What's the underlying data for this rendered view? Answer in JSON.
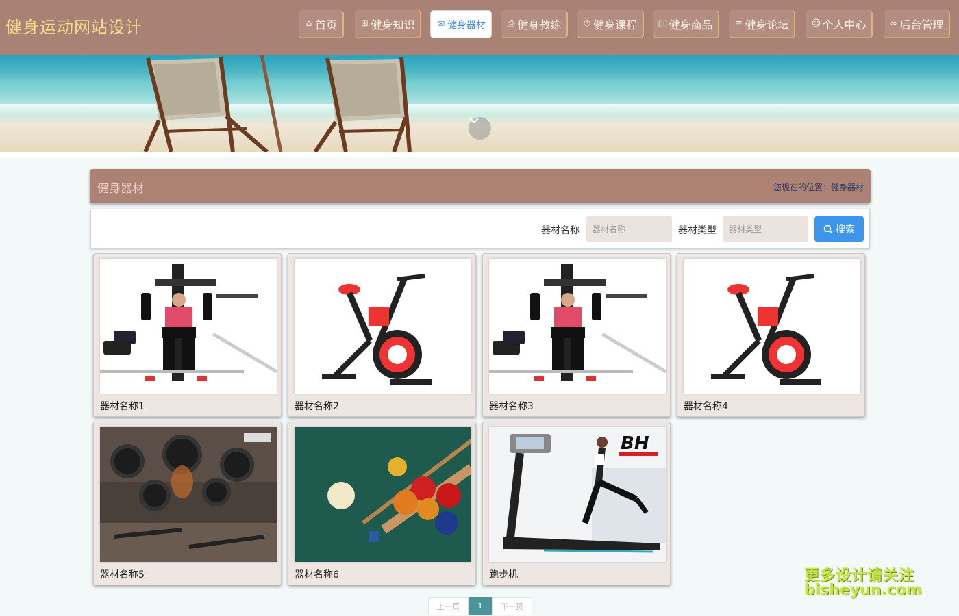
{
  "header": {
    "site_title": "健身运动网站设计",
    "nav": [
      {
        "label": "首页",
        "icon": "home-icon",
        "glyph": "⌂",
        "active": false
      },
      {
        "label": "健身知识",
        "icon": "gift-icon",
        "glyph": "⊞",
        "active": false
      },
      {
        "label": "健身器材",
        "icon": "mail-icon",
        "glyph": "✉",
        "active": true
      },
      {
        "label": "健身教练",
        "icon": "printer-icon",
        "glyph": "⎙",
        "active": false
      },
      {
        "label": "健身课程",
        "icon": "power-icon",
        "glyph": "⏻",
        "active": false
      },
      {
        "label": "健身商品",
        "icon": "book-icon",
        "glyph": "▯▯",
        "active": false
      },
      {
        "label": "健身论坛",
        "icon": "list-icon",
        "glyph": "≡",
        "active": false
      },
      {
        "label": "个人中心",
        "icon": "user-icon",
        "glyph": "☺",
        "active": false
      },
      {
        "label": "后台管理",
        "icon": "link-icon",
        "glyph": "∞",
        "active": false
      }
    ]
  },
  "banner": {
    "scroll_icon": "chevron-down-icon"
  },
  "section": {
    "title": "健身器材",
    "breadcrumb": "您现在的位置：健身器材"
  },
  "search": {
    "name_label": "器材名称",
    "name_placeholder": "器材名称",
    "type_label": "器材类型",
    "type_placeholder": "器材类型",
    "button_label": "搜索",
    "button_icon": "search-icon"
  },
  "items": [
    {
      "name": "器材名称1",
      "image": "home-gym-machine"
    },
    {
      "name": "器材名称2",
      "image": "spin-bike"
    },
    {
      "name": "器材名称3",
      "image": "home-gym-machine"
    },
    {
      "name": "器材名称4",
      "image": "spin-bike"
    },
    {
      "name": "器材名称5",
      "image": "gym-interior-tires"
    },
    {
      "name": "器材名称6",
      "image": "billiard-balls"
    },
    {
      "name": "跑步机",
      "image": "treadmill-runner"
    }
  ],
  "pagination": {
    "prev": "上一页",
    "current": "1",
    "next": "下一页"
  },
  "watermark": {
    "line1": "更多设计请关注",
    "line2": "bisheyun.com"
  }
}
